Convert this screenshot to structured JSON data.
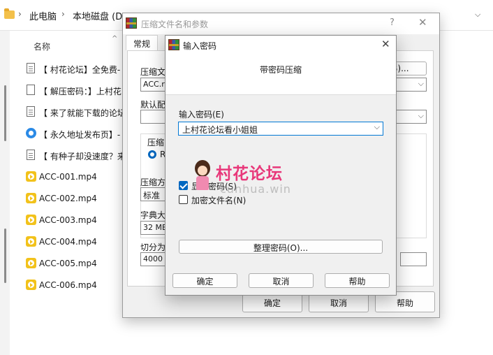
{
  "explorer": {
    "breadcrumb": [
      "此电脑",
      "本地磁盘 (D:)"
    ],
    "column_header": "名称",
    "files": [
      {
        "name": "【 村花论坛】全免费-",
        "icon": "document-icon"
      },
      {
        "name": "【 解压密码：】上村花",
        "icon": "blank-document-icon"
      },
      {
        "name": "【 来了就能下载的论坛",
        "icon": "document-icon"
      },
      {
        "name": "【 永久地址发布页】-",
        "icon": "edge-browser-icon"
      },
      {
        "name": "【 有种子却没速度？来",
        "icon": "document-icon"
      },
      {
        "name": "ACC-001.mp4",
        "icon": "video-file-icon"
      },
      {
        "name": "ACC-002.mp4",
        "icon": "video-file-icon"
      },
      {
        "name": "ACC-003.mp4",
        "icon": "video-file-icon"
      },
      {
        "name": "ACC-004.mp4",
        "icon": "video-file-icon"
      },
      {
        "name": "ACC-005.mp4",
        "icon": "video-file-icon"
      },
      {
        "name": "ACC-006.mp4",
        "icon": "video-file-icon"
      }
    ]
  },
  "archive_dialog": {
    "title": "压缩文件名和参数",
    "help": "?",
    "close": "✕",
    "tab_general": "常规",
    "archive_name_label": "压缩文",
    "archive_name_value": "ACC.ra",
    "browse_button": "(B)...",
    "default_profile_label": "默认配",
    "format_group_label": "压缩",
    "format_rar": "RA",
    "method_label": "压缩方",
    "method_value": "标准",
    "dict_label": "字典大",
    "dict_value": "32 MB",
    "split_label": "切分为",
    "split_value": "4000",
    "ok": "确定",
    "cancel": "取消",
    "help_button": "帮助"
  },
  "password_dialog": {
    "title": "输入密码",
    "close": "✕",
    "header": "带密码压缩",
    "enter_label": "输入密码(E)",
    "password_value": "上村花论坛看小姐姐",
    "show_password": "显示密码(S)",
    "show_password_checked": true,
    "encrypt_names": "加密文件名(N)",
    "encrypt_names_checked": false,
    "manage_button": "整理密码(O)...",
    "ok": "确定",
    "cancel": "取消",
    "help_button": "帮助"
  },
  "watermark": {
    "brand": "村花论坛",
    "url": "cunhua.win"
  }
}
